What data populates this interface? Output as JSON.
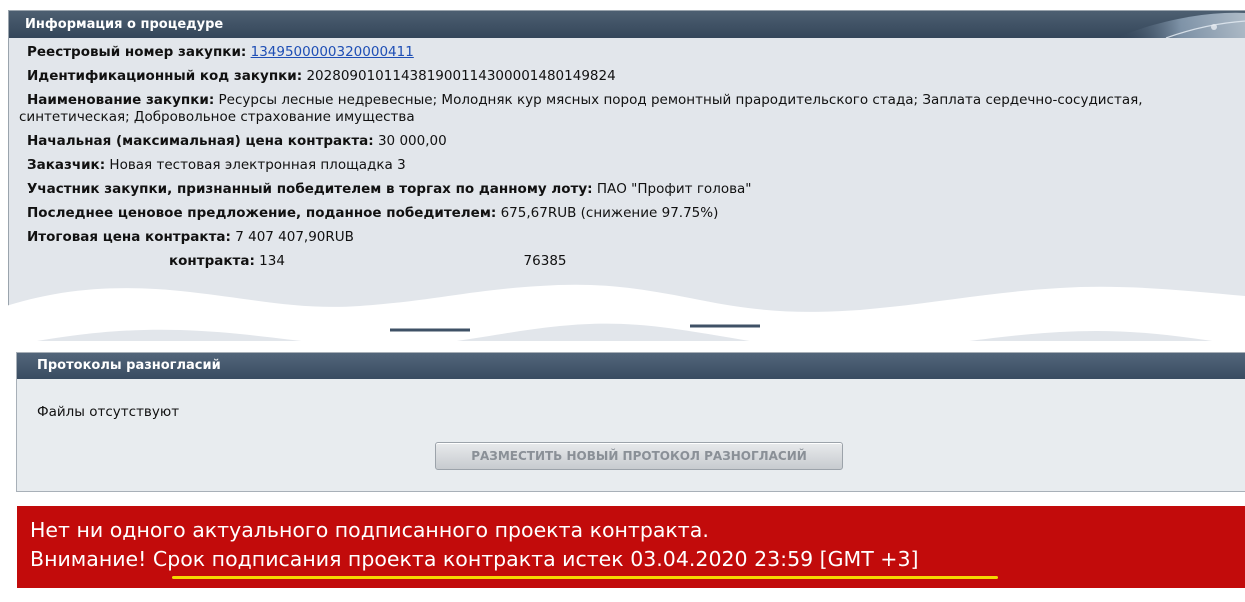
{
  "procedure": {
    "header": "Информация о процедуре",
    "registry_label": "Реестровый номер закупки",
    "registry_value": "1349500000320000411",
    "ident_label": "Идентификационный код закупки",
    "ident_value": "202809010114381900114300001480149824",
    "name_label": "Наименование закупки",
    "name_value": "Ресурсы лесные недревесные; Молодняк кур мясных пород ремонтный прародительского стада; Заплата сердечно-сосудистая, синтетическая; Добровольное страхование имущества",
    "price_label": "Начальная (максимальная) цена контракта",
    "price_value": "30 000,00",
    "customer_label": "Заказчик",
    "customer_value": "Новая тестовая электронная площадка 3",
    "winner_label": "Участник закупки, признанный победителем в торгах по данному лоту",
    "winner_value": "ПАО \"Профит голова\"",
    "last_offer_label": "Последнее ценовое предложение, поданное победителем",
    "last_offer_value": "675,67RUB (снижение 97.75%)",
    "final_price_label": "Итоговая цена контракта",
    "final_price_value": "7 407 407,90RUB",
    "contract_partial_label": "контракта",
    "contract_partial_value_a": "134",
    "contract_partial_value_b": "76385"
  },
  "protocols": {
    "header": "Протоколы разногласий",
    "no_files": "Файлы отсутствуют",
    "new_button": "РАЗМЕСТИТЬ НОВЫЙ ПРОТОКОЛ РАЗНОГЛАСИЙ"
  },
  "alert": {
    "line1": "Нет ни одного актуального подписанного проекта контракта.",
    "line2_prefix": "Внимание!",
    "line2_rest": "Срок подписания проекта контракта истек 03.04.2020 23:59 [GMT +3]",
    "color": "#c20b0b",
    "underline_color": "#f5d800"
  }
}
